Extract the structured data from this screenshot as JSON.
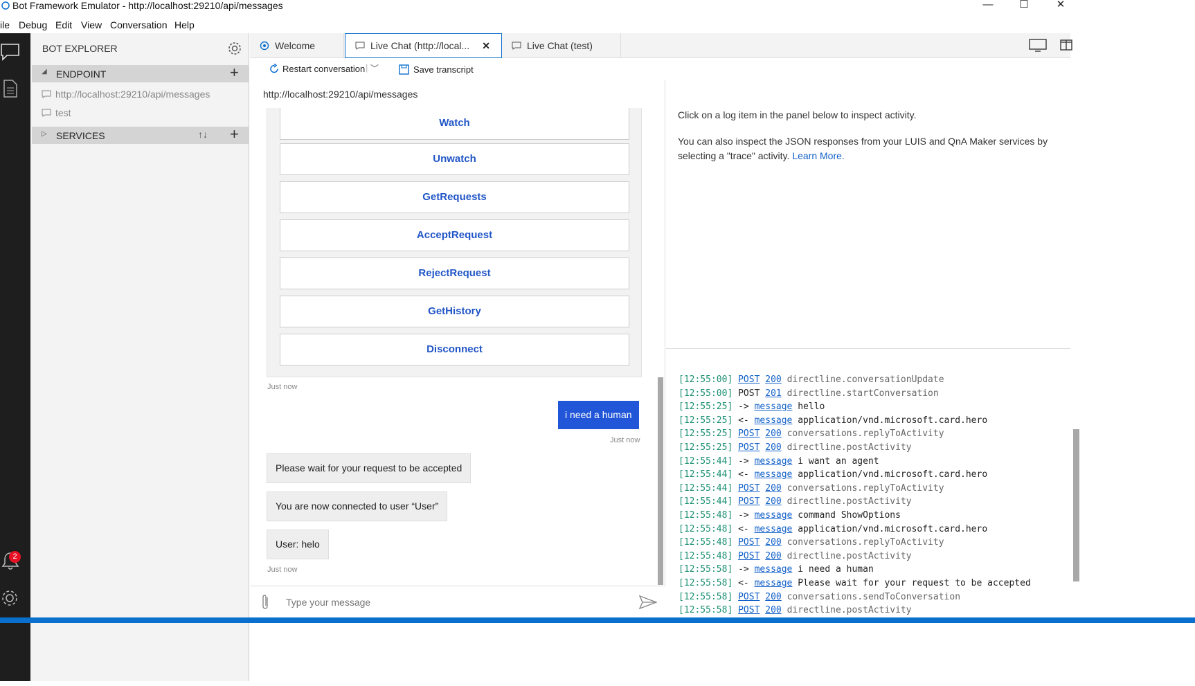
{
  "window": {
    "title": "Bot Framework Emulator - http://localhost:29210/api/messages",
    "minimize_glyph": "—",
    "maximize_glyph": "☐",
    "close_glyph": "✕"
  },
  "menu": [
    "ile",
    "Debug",
    "Edit",
    "View",
    "Conversation",
    "Help"
  ],
  "nav": {
    "notification_count": "2"
  },
  "explorer": {
    "title": "BOT EXPLORER",
    "endpoint_label": "ENDPOINT",
    "endpoints": [
      "http://localhost:29210/api/messages",
      "test"
    ],
    "services_label": "SERVICES"
  },
  "tabs": [
    {
      "label": "Welcome"
    },
    {
      "label": "Live Chat (http://local..."
    },
    {
      "label": "Live Chat (test)"
    }
  ],
  "toolbar": {
    "restart_label": "Restart conversation",
    "save_label": "Save transcript"
  },
  "chat": {
    "url": "http://localhost:29210/api/messages",
    "card_buttons": [
      "Watch",
      "Unwatch",
      "GetRequests",
      "AcceptRequest",
      "RejectRequest",
      "GetHistory",
      "Disconnect"
    ],
    "timestamp_1": "Just now",
    "user_message": "i need a human",
    "timestamp_2": "Just now",
    "bot_messages": [
      "Please wait for your request to be accepted",
      "You are now connected to user “User”",
      "User: helo"
    ],
    "timestamp_3": "Just now",
    "input_placeholder": "Type your message"
  },
  "inspector": {
    "line1": "Click on a log item in the panel below to inspect activity.",
    "line2a": "You can also inspect the JSON responses from your LUIS and QnA Maker services by",
    "line2b": "selecting a \"trace\" activity.",
    "learn_more": "Learn More."
  },
  "log": [
    {
      "time": "[12:55:00]",
      "a": "POST",
      "a_link": true,
      "b": "200",
      "b_link": true,
      "text": "directline.conversationUpdate",
      "text_gray": true
    },
    {
      "time": "[12:55:00]",
      "a": "POST",
      "a_link": false,
      "b": "201",
      "b_link": true,
      "text": "directline.startConversation",
      "text_gray": true
    },
    {
      "time": "[12:55:25]",
      "a": "->",
      "a_link": false,
      "b": "message",
      "b_link": true,
      "text": "hello",
      "text_gray": false
    },
    {
      "time": "[12:55:25]",
      "a": "<-",
      "a_link": false,
      "b": "message",
      "b_link": true,
      "text": "application/vnd.microsoft.card.hero",
      "text_gray": false
    },
    {
      "time": "[12:55:25]",
      "a": "POST",
      "a_link": true,
      "b": "200",
      "b_link": true,
      "text": "conversations.replyToActivity",
      "text_gray": true
    },
    {
      "time": "[12:55:25]",
      "a": "POST",
      "a_link": true,
      "b": "200",
      "b_link": true,
      "text": "directline.postActivity",
      "text_gray": true
    },
    {
      "time": "[12:55:44]",
      "a": "->",
      "a_link": false,
      "b": "message",
      "b_link": true,
      "text": "i want an agent",
      "text_gray": false
    },
    {
      "time": "[12:55:44]",
      "a": "<-",
      "a_link": false,
      "b": "message",
      "b_link": true,
      "text": "application/vnd.microsoft.card.hero",
      "text_gray": false
    },
    {
      "time": "[12:55:44]",
      "a": "POST",
      "a_link": true,
      "b": "200",
      "b_link": true,
      "text": "conversations.replyToActivity",
      "text_gray": true
    },
    {
      "time": "[12:55:44]",
      "a": "POST",
      "a_link": true,
      "b": "200",
      "b_link": true,
      "text": "directline.postActivity",
      "text_gray": true
    },
    {
      "time": "[12:55:48]",
      "a": "->",
      "a_link": false,
      "b": "message",
      "b_link": true,
      "text": "command ShowOptions",
      "text_gray": false
    },
    {
      "time": "[12:55:48]",
      "a": "<-",
      "a_link": false,
      "b": "message",
      "b_link": true,
      "text": "application/vnd.microsoft.card.hero",
      "text_gray": false
    },
    {
      "time": "[12:55:48]",
      "a": "POST",
      "a_link": true,
      "b": "200",
      "b_link": true,
      "text": "conversations.replyToActivity",
      "text_gray": true
    },
    {
      "time": "[12:55:48]",
      "a": "POST",
      "a_link": true,
      "b": "200",
      "b_link": true,
      "text": "directline.postActivity",
      "text_gray": true
    },
    {
      "time": "[12:55:58]",
      "a": "->",
      "a_link": false,
      "b": "message",
      "b_link": true,
      "text": "i need a human",
      "text_gray": false
    },
    {
      "time": "[12:55:58]",
      "a": "<-",
      "a_link": false,
      "b": "message",
      "b_link": true,
      "text": "Please wait for your request to be accepted",
      "text_gray": false
    },
    {
      "time": "[12:55:58]",
      "a": "POST",
      "a_link": true,
      "b": "200",
      "b_link": true,
      "text": "conversations.sendToConversation",
      "text_gray": true
    },
    {
      "time": "[12:55:58]",
      "a": "POST",
      "a_link": true,
      "b": "200",
      "b_link": true,
      "text": "directline.postActivity",
      "text_gray": true
    }
  ],
  "colors": {
    "accent": "#0b6fce",
    "user_bubble": "#2156d8",
    "card_button_text": "#2156c7",
    "log_time": "#1a8f72",
    "log_link": "#1160c8",
    "nav_bg": "#1e1e1e",
    "badge": "#e81123"
  }
}
